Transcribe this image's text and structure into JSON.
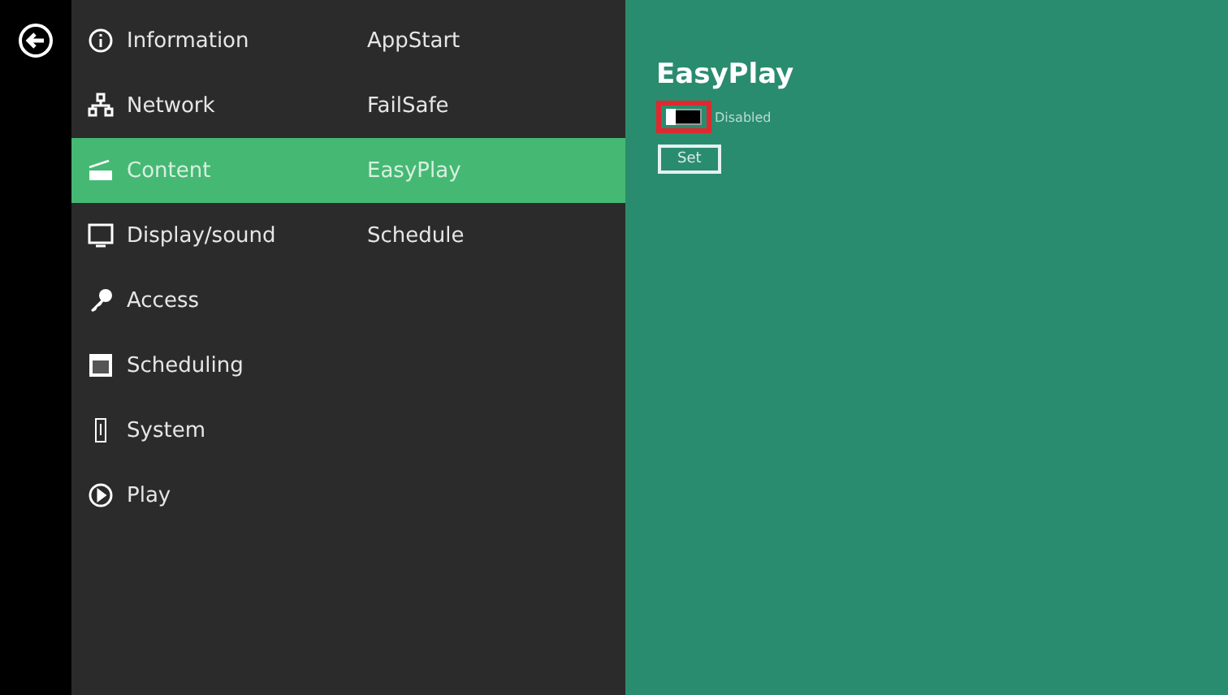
{
  "menu": [
    {
      "kind": "info",
      "label": "Information",
      "sub": "AppStart",
      "selected": false
    },
    {
      "kind": "network",
      "label": "Network",
      "sub": "FailSafe",
      "selected": false
    },
    {
      "kind": "content",
      "label": "Content",
      "sub": "EasyPlay",
      "selected": true
    },
    {
      "kind": "display",
      "label": "Display/sound",
      "sub": "Schedule",
      "selected": false
    },
    {
      "kind": "key",
      "label": "Access",
      "selected": false
    },
    {
      "kind": "calendar",
      "label": "Scheduling",
      "selected": false
    },
    {
      "kind": "system",
      "label": "System",
      "selected": false
    },
    {
      "kind": "play",
      "label": "Play",
      "selected": false
    }
  ],
  "panel": {
    "title": "EasyPlay",
    "toggle": {
      "on": false,
      "label": "Disabled"
    },
    "button": "Set"
  }
}
